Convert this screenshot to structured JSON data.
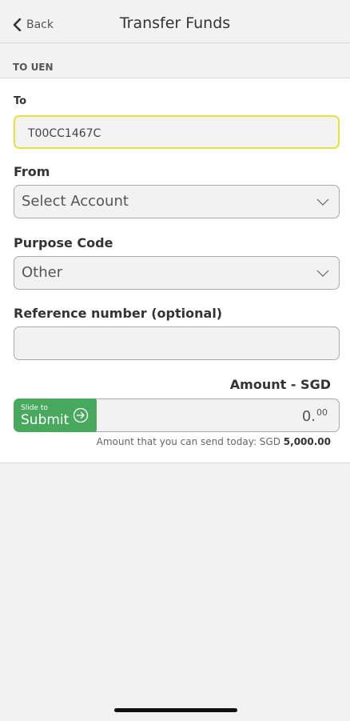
{
  "header": {
    "back_label": "Back",
    "title": "Transfer Funds"
  },
  "section": {
    "label": "TO UEN"
  },
  "to": {
    "label": "To",
    "value": "T00CC1467C"
  },
  "from": {
    "label": "From",
    "value": "Select Account"
  },
  "purpose": {
    "label": "Purpose Code",
    "value": "Other"
  },
  "reference": {
    "label": "Reference number (optional)",
    "value": ""
  },
  "amount": {
    "label": "Amount - SGD",
    "integer": "0.",
    "decimals": "00",
    "limit_prefix": "Amount that you can send today: SGD ",
    "limit_value": "5,000.00"
  },
  "submit": {
    "small_label": "Slide to",
    "label": "Submit"
  },
  "colors": {
    "submit_green": "#48a85e",
    "active_border": "#e5e23a"
  },
  "icons": {
    "back": "chevron-left-icon",
    "dropdown": "chevron-down-icon",
    "submit": "arrow-right-circle-icon"
  }
}
